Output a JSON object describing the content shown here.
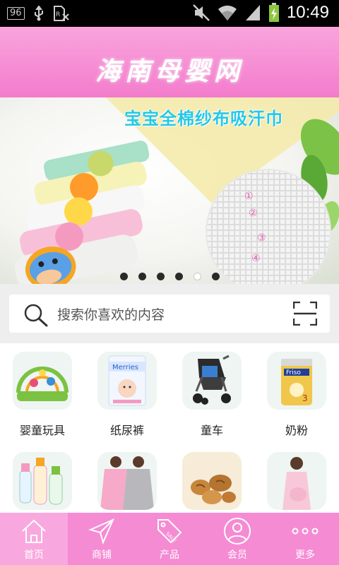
{
  "status_bar": {
    "notification_count": "96",
    "time": "10:49",
    "icons": [
      "usb-icon",
      "sim-icon",
      "mute-icon",
      "wifi-icon",
      "signal-icon",
      "battery-icon"
    ]
  },
  "header": {
    "title": "海南母婴网"
  },
  "banner": {
    "caption": "宝宝全棉纱布吸汗巾",
    "markers": [
      "①",
      "②",
      "③",
      "④"
    ],
    "slide_count": 6,
    "active_slide": 5
  },
  "search": {
    "placeholder": "搜索你喜欢的内容"
  },
  "categories": [
    {
      "label": "婴童玩具",
      "icon": "baby-gym-image"
    },
    {
      "label": "纸尿裤",
      "icon": "diaper-pack-image"
    },
    {
      "label": "童车",
      "icon": "stroller-image"
    },
    {
      "label": "奶粉",
      "icon": "formula-can-image"
    },
    {
      "label": "",
      "icon": "baby-bottles-image"
    },
    {
      "label": "",
      "icon": "nursing-cape-image"
    },
    {
      "label": "",
      "icon": "walnut-snacks-image"
    },
    {
      "label": "",
      "icon": "maternity-wear-image"
    }
  ],
  "nav": [
    {
      "label": "首页",
      "icon": "home-icon"
    },
    {
      "label": "商铺",
      "icon": "send-icon"
    },
    {
      "label": "产品",
      "icon": "sale-tag-icon"
    },
    {
      "label": "会员",
      "icon": "user-icon"
    },
    {
      "label": "更多",
      "icon": "more-icon"
    }
  ],
  "colors": {
    "accent_pink": "#f58bd3",
    "caption_cyan": "#23c8e8"
  }
}
